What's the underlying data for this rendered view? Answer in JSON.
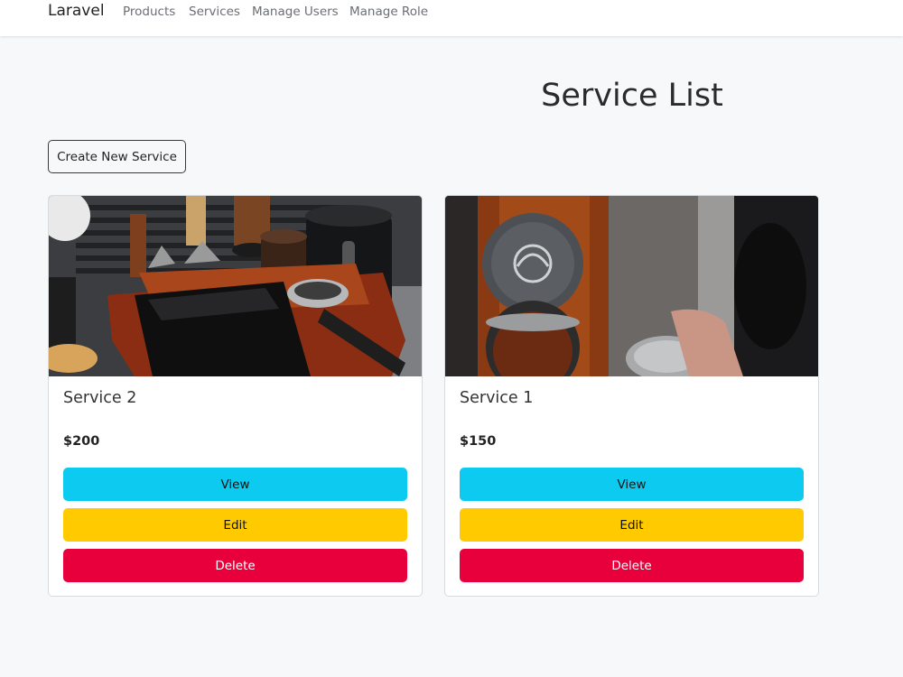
{
  "navbar": {
    "brand": "Laravel",
    "links": [
      "Products",
      "Services",
      "Manage Users",
      "Manage Role"
    ]
  },
  "page": {
    "title": "Service List",
    "create_button": "Create New Service"
  },
  "services": [
    {
      "title": "Service 2",
      "price": "$200",
      "image_desc": "espresso-accessory-station-image",
      "buttons": {
        "view": "View",
        "edit": "Edit",
        "delete": "Delete"
      }
    },
    {
      "title": "Service 1",
      "price": "$150",
      "image_desc": "coffee-tamper-image",
      "buttons": {
        "view": "View",
        "edit": "Edit",
        "delete": "Delete"
      }
    }
  ],
  "colors": {
    "view": "#0dcaf0",
    "edit": "#ffca00",
    "delete": "#e8003d",
    "background": "#f7f8fa"
  }
}
